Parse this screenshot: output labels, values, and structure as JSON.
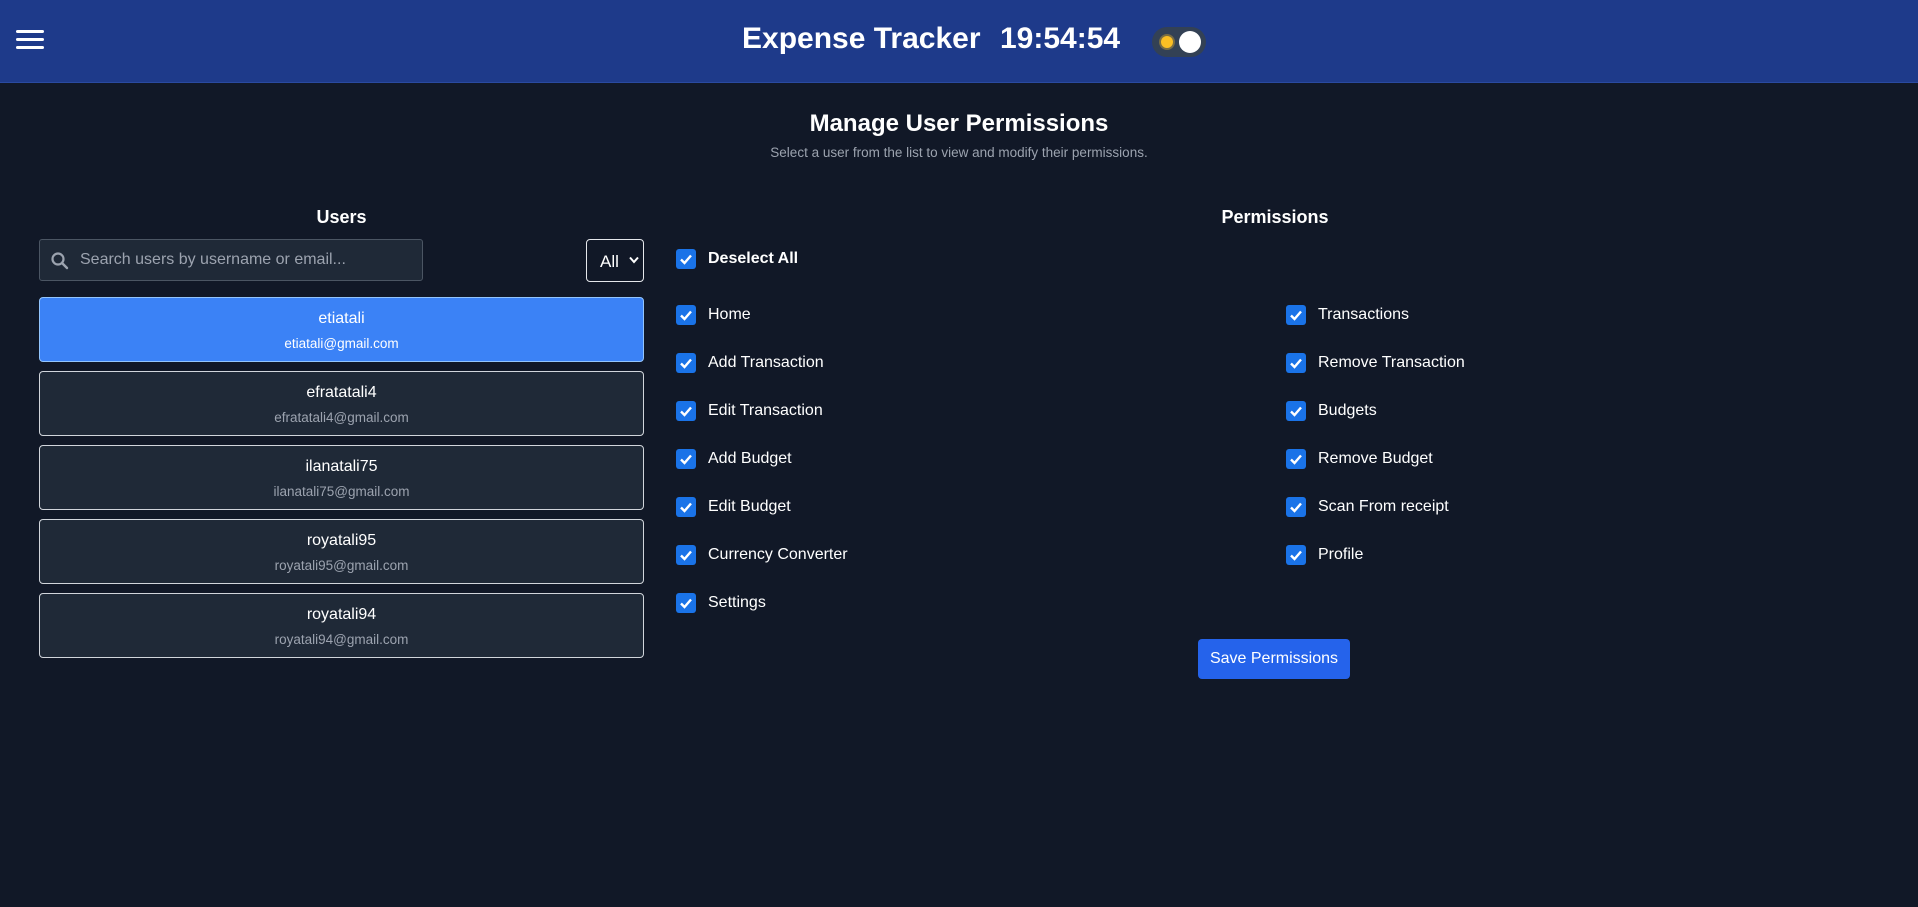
{
  "header": {
    "title": "Expense Tracker",
    "clock": "19:54:54"
  },
  "page": {
    "title": "Manage User Permissions",
    "subtitle": "Select a user from the list to view and modify their permissions."
  },
  "users_panel": {
    "heading": "Users",
    "search_placeholder": "Search users by username or email...",
    "search_value": "",
    "filter_selected": "All",
    "users": [
      {
        "username": "etiatali",
        "email": "etiatali@gmail.com",
        "selected": true
      },
      {
        "username": "efratatali4",
        "email": "efratatali4@gmail.com",
        "selected": false
      },
      {
        "username": "ilanatali75",
        "email": "ilanatali75@gmail.com",
        "selected": false
      },
      {
        "username": "royatali95",
        "email": "royatali95@gmail.com",
        "selected": false
      },
      {
        "username": "royatali94",
        "email": "royatali94@gmail.com",
        "selected": false
      }
    ]
  },
  "permissions_panel": {
    "heading": "Permissions",
    "select_all_label": "Deselect All",
    "left_column": [
      {
        "label": "Home",
        "checked": true
      },
      {
        "label": "Add Transaction",
        "checked": true
      },
      {
        "label": "Edit Transaction",
        "checked": true
      },
      {
        "label": "Add Budget",
        "checked": true
      },
      {
        "label": "Edit Budget",
        "checked": true
      },
      {
        "label": "Currency Converter",
        "checked": true
      },
      {
        "label": "Settings",
        "checked": true
      }
    ],
    "right_column": [
      {
        "label": "Transactions",
        "checked": true
      },
      {
        "label": "Remove Transaction",
        "checked": true
      },
      {
        "label": "Budgets",
        "checked": true
      },
      {
        "label": "Remove Budget",
        "checked": true
      },
      {
        "label": "Scan From receipt",
        "checked": true
      },
      {
        "label": "Profile",
        "checked": true
      }
    ],
    "save_label": "Save Permissions"
  },
  "colors": {
    "background": "#111827",
    "header": "#1e3a8a",
    "selected_user": "#3b82f6",
    "checkbox": "#1a73e8",
    "save_button": "#2563eb"
  }
}
